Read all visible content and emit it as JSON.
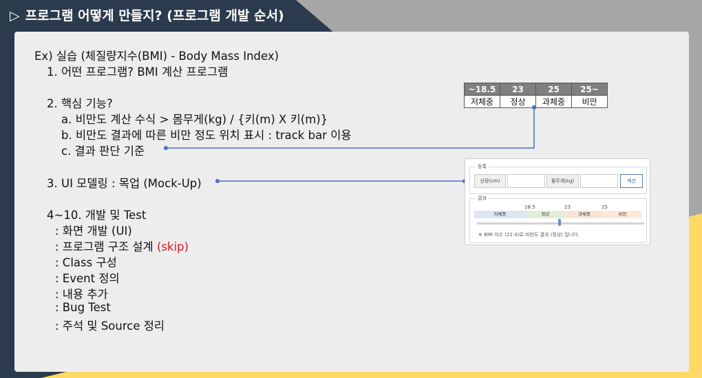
{
  "title": "프로그램 어떻게 만들지? (프로그램 개발 순서)",
  "title_icon": "play-triangle-icon",
  "lines": {
    "l1": "Ex) 실습 (체질량지수(BMI) - Body Mass Index)",
    "l2": "1. 어떤 프로그램? BMI 계산 프로그램",
    "l3": "2. 핵심 기능?",
    "l4": "a. 비만도 계산 수식 > 몸무게(kg) / {키(m) X 키(m)}",
    "l5": "b. 비만도 결과에 따른 비만 정도 위치 표시 : track bar 이용",
    "l6": "c. 결과 판단 기준",
    "l7": "3. UI 모델링 : 목업 (Mock-Up)",
    "l8": "4~10. 개발 및 Test",
    "l9": ": 화면 개발 (UI)",
    "l10": ": 프로그램 구조 설계",
    "l10_skip": "(skip)",
    "l11": ": Class 구성",
    "l12": ": Event 정의",
    "l13": ": 내용 추가",
    "l14": ": Bug Test",
    "l15": ": 주석 및 Source 정리"
  },
  "bmi_table": {
    "headers": [
      "~18.5",
      "23",
      "25",
      "25~"
    ],
    "labels": [
      "저체중",
      "정상",
      "과체중",
      "비만"
    ]
  },
  "mockup": {
    "register_label": "등록",
    "height_label": "신장(cm)",
    "weight_label": "몸무게(kg)",
    "calc_button": "계산",
    "result_label": "결과",
    "ticks": [
      "18.5",
      "23",
      "25"
    ],
    "segments": [
      "저체중",
      "정상",
      "과체중",
      "비만"
    ],
    "segment_colors": [
      "#dce6f4",
      "#e2efd9",
      "#fbe4d5",
      "#fde9d9"
    ],
    "track_value": 22.4,
    "note": "※ BMI 지수 (22.4)로 비만도 결과 (정상) 입니다."
  },
  "colors": {
    "dark_bg": "#2b3a4c",
    "gray_band": "#a6a6a6",
    "yellow_accent": "#ffd966",
    "panel": "#ededed",
    "connector": "#4472c4",
    "skip": "#e0141e"
  }
}
